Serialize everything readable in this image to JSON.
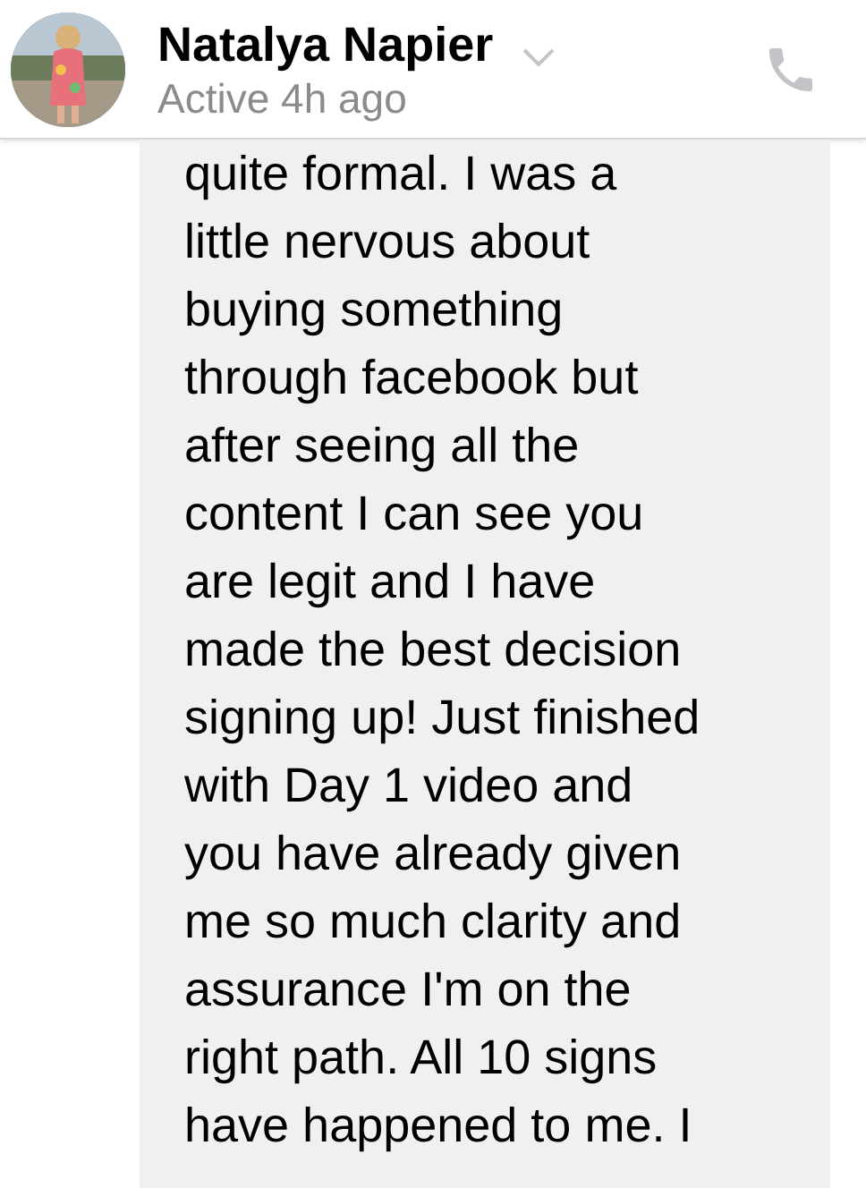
{
  "header": {
    "name": "Natalya Napier",
    "status": "Active 4h ago"
  },
  "message": {
    "lines": [
      "quite formal. I was a",
      "little nervous about",
      "buying something",
      "through facebook but",
      "after seeing all the",
      "content I can see you",
      "are legit and I have",
      "made the best decision",
      "signing up! Just finished",
      "with Day 1 video and",
      "you have already given",
      "me so much clarity and",
      "assurance I'm on the",
      "right path. All 10 signs",
      "have happened to me. I"
    ]
  }
}
